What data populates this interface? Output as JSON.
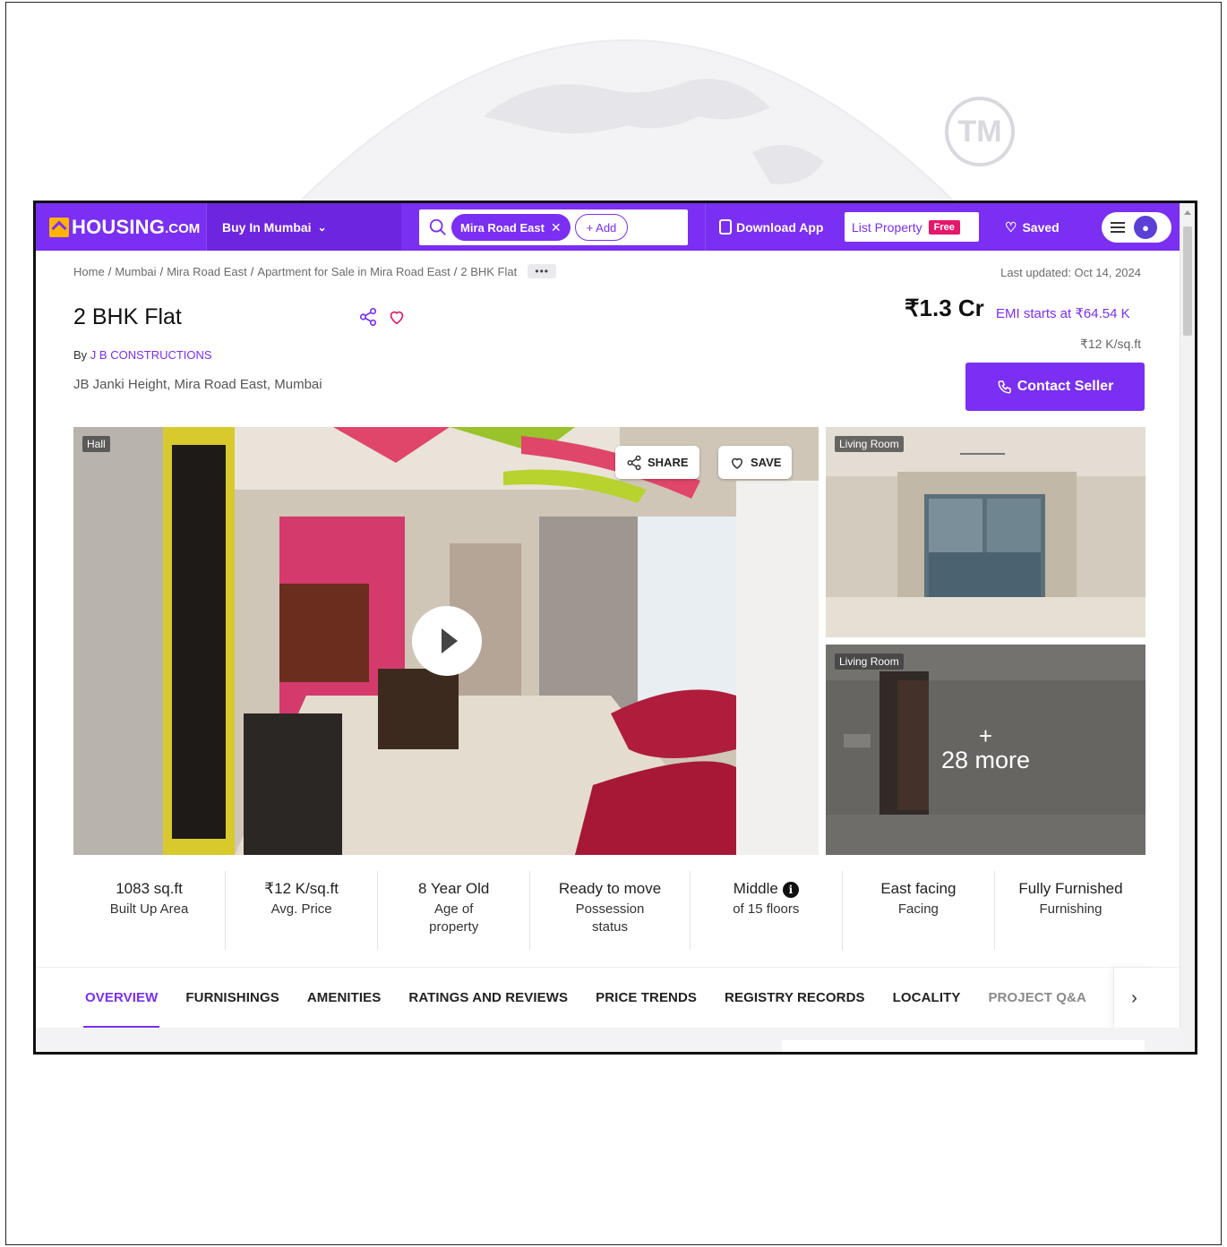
{
  "watermark": {
    "mark": "TM"
  },
  "header": {
    "logo": {
      "main": "HOUSING",
      "sub": ".COM"
    },
    "buy_menu": "Buy In Mumbai",
    "search": {
      "chip": "Mira Road East",
      "add": "+ Add"
    },
    "download_app": "Download App",
    "list_property": "List Property",
    "free_badge": "Free",
    "saved": "Saved"
  },
  "breadcrumb": {
    "items": [
      "Home",
      "Mumbai",
      "Mira Road East",
      "Apartment for Sale in Mira Road East",
      "2 BHK Flat"
    ],
    "more": "•••"
  },
  "last_updated": "Last updated: Oct 14, 2024",
  "listing": {
    "title": "2 BHK Flat",
    "by_prefix": "By",
    "developer": "J B CONSTRUCTIONS",
    "address": "JB Janki Height, Mira Road East, Mumbai",
    "price": "₹1.3 Cr",
    "emi": "EMI starts at ₹64.54 K",
    "price_per_sqft": "₹12 K/sq.ft",
    "contact_button": "Contact Seller"
  },
  "gallery": {
    "main_tag": "Hall",
    "share": "SHARE",
    "save": "SAVE",
    "side_tags": [
      "Living Room",
      "Living Room"
    ],
    "more_plus": "+",
    "more_text": "28 more"
  },
  "stats": [
    {
      "value": "1083 sq.ft",
      "label": "Built Up Area"
    },
    {
      "value": "₹12 K/sq.ft",
      "label": "Avg. Price"
    },
    {
      "value": "8 Year Old",
      "label": "Age of property"
    },
    {
      "value": "Ready to move",
      "label": "Possession status"
    },
    {
      "value": "Middle",
      "label": "of 15 floors"
    },
    {
      "value": "East facing",
      "label": "Facing"
    },
    {
      "value": "Fully Furnished",
      "label": "Furnishing"
    }
  ],
  "tabs": [
    "OVERVIEW",
    "FURNISHINGS",
    "AMENITIES",
    "RATINGS AND REVIEWS",
    "PRICE TRENDS",
    "REGISTRY RECORDS",
    "LOCALITY",
    "PROJECT Q&A"
  ],
  "colors": {
    "brand": "#7a2ff2",
    "accent_pink": "#e5176b",
    "logo_yellow": "#ffb400"
  }
}
